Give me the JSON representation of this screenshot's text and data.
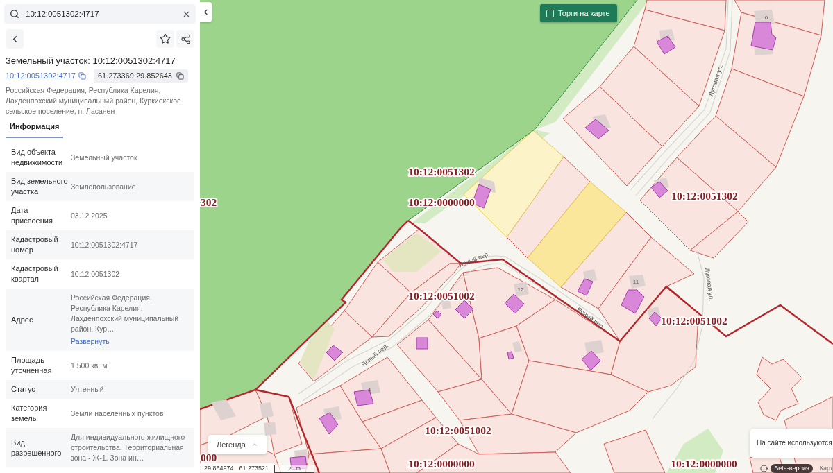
{
  "search": {
    "value": "10:12:0051302:4717"
  },
  "object": {
    "title": "Земельный участок: 10:12:0051302:4717",
    "cadastral_number": "10:12:0051302:4717",
    "coordinates": "61.273369 29.852643",
    "address": "Российская Федерация, Республика Карелия, Лахденпохский муниципальный район, Куркиёкское сельское поселение, п. Ласанен"
  },
  "tabs": [
    {
      "label": "Информация",
      "selected": true
    }
  ],
  "properties": [
    {
      "label": "Вид объекта недвижимости",
      "value": "Земельный участок"
    },
    {
      "label": "Вид земельного участка",
      "value": "Землепользование"
    },
    {
      "label": "Дата присвоения",
      "value": "03.12.2025"
    },
    {
      "label": "Кадастровый номер",
      "value": "10:12:0051302:4717"
    },
    {
      "label": "Кадастровый квартал",
      "value": "10:12:0051302"
    },
    {
      "label": "Адрес",
      "value": "Российская Федерация, Республика Карелия, Лахденпохский муниципальный район, Кур…",
      "link": "Развернуть"
    },
    {
      "label": "Площадь уточненная",
      "value": "1 500 кв. м"
    },
    {
      "label": "Статус",
      "value": "Учтенный"
    },
    {
      "label": "Категория земель",
      "value": "Земли населенных пунктов"
    },
    {
      "label": "Вид разрешенного",
      "value": "Для индивидуального жилищного строительства. Территориальная зона - Ж-1. Зона ин…"
    }
  ],
  "map": {
    "auction_toggle": {
      "label": "Торги на карте",
      "checked": false
    },
    "quarter_labels": [
      "10:12:0051302",
      "302",
      "10:12:0000000",
      "10:12:0051302",
      "10:12:0051002",
      "10:12:0051002",
      "10:12:0051002",
      "000",
      "10:12:0000000",
      "10:12:0000000"
    ],
    "street_labels": [
      "Луговая ул.",
      "Ясный пер.",
      "Луговая ул.",
      "Ясный пер.",
      "Ясный пер."
    ],
    "house_numbers": [
      "6",
      "7",
      "11",
      "12",
      "4"
    ],
    "legend_button": {
      "label": "Легенда"
    },
    "cursor_coordinates": [
      "29.854974",
      "61.273521"
    ],
    "scale": "20 m",
    "cookie_notice": "На сайте используются",
    "beta_badge": "Beta-версия",
    "attribution": "Карт"
  }
}
